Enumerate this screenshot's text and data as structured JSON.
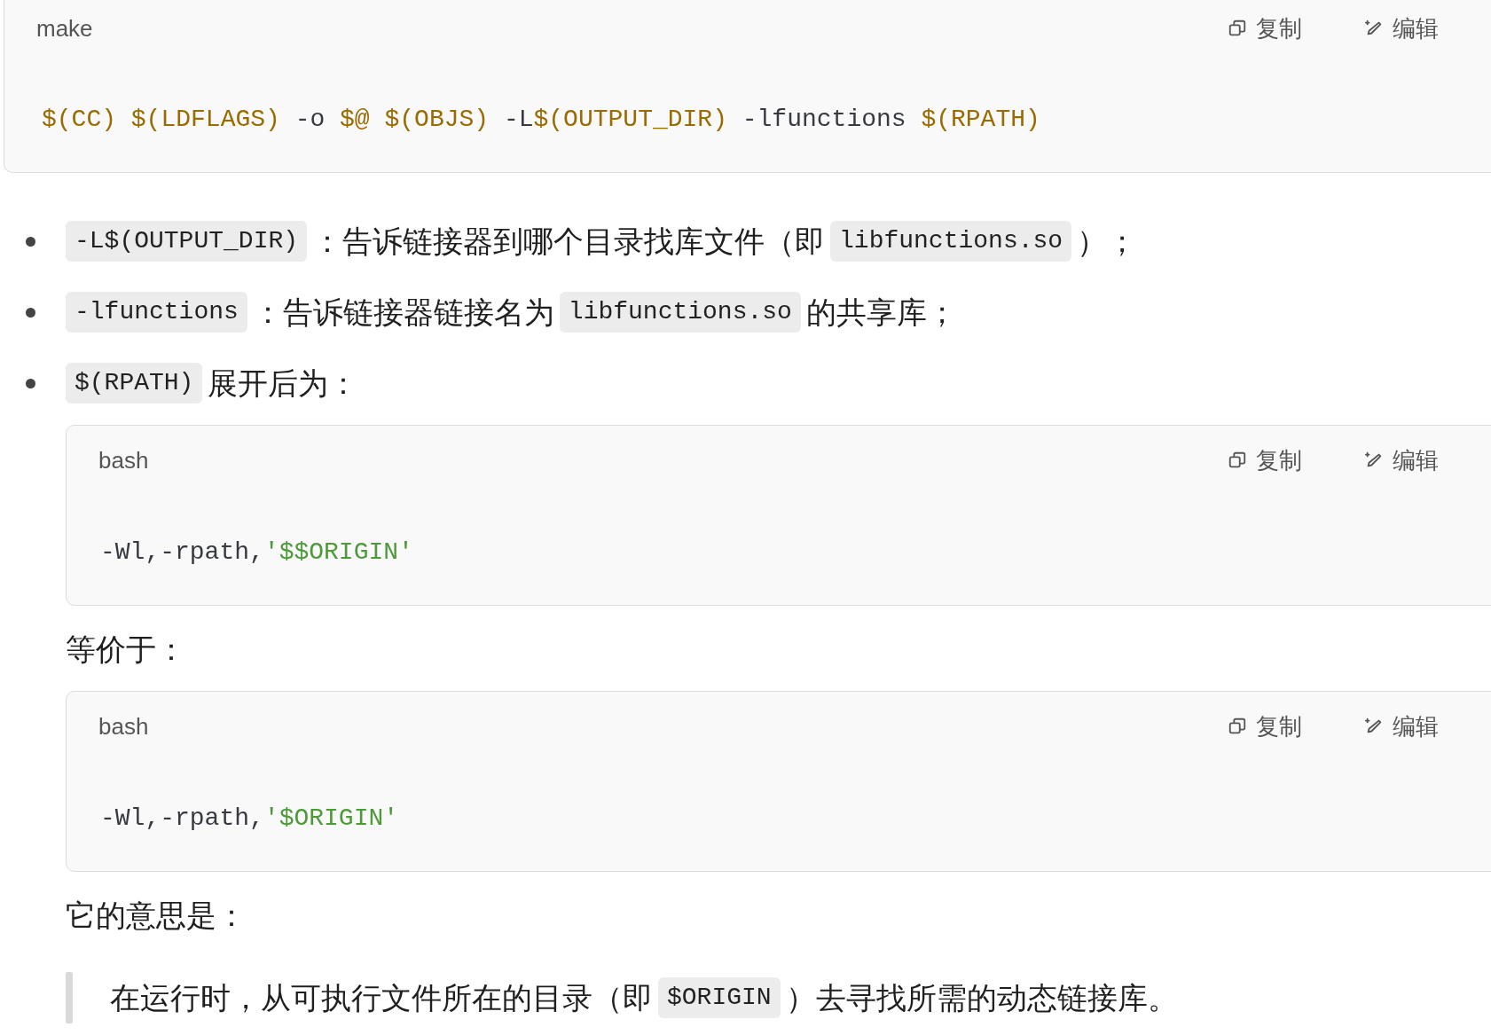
{
  "blocks": [
    {
      "kind": "code",
      "nested": false,
      "language": "make",
      "copy_label": "复制",
      "edit_label": "编辑",
      "tokens": [
        {
          "kind": "var",
          "text": "$(CC) $(LDFLAGS)"
        },
        {
          "kind": "plain",
          "text": " -o "
        },
        {
          "kind": "var",
          "text": "$@ $(OBJS)"
        },
        {
          "kind": "plain",
          "text": " -L"
        },
        {
          "kind": "var",
          "text": "$(OUTPUT_DIR)"
        },
        {
          "kind": "plain",
          "text": " -lfunctions "
        },
        {
          "kind": "var",
          "text": "$(RPATH)"
        }
      ]
    },
    {
      "kind": "bullets",
      "items": [
        {
          "segments": [
            {
              "kind": "code",
              "text": "-L$(OUTPUT_DIR)"
            },
            {
              "kind": "text",
              "text": "：告诉链接器到哪个目录找库文件（即"
            },
            {
              "kind": "code",
              "text": "libfunctions.so"
            },
            {
              "kind": "text",
              "text": "）；"
            }
          ]
        },
        {
          "segments": [
            {
              "kind": "code",
              "text": "-lfunctions"
            },
            {
              "kind": "text",
              "text": "：告诉链接器链接名为"
            },
            {
              "kind": "code",
              "text": "libfunctions.so"
            },
            {
              "kind": "text",
              "text": "的共享库；"
            }
          ]
        },
        {
          "segments": [
            {
              "kind": "code",
              "text": "$(RPATH)"
            },
            {
              "kind": "text",
              "text": "展开后为："
            }
          ]
        }
      ]
    },
    {
      "kind": "code",
      "nested": true,
      "language": "bash",
      "copy_label": "复制",
      "edit_label": "编辑",
      "tokens": [
        {
          "kind": "plain",
          "text": "-Wl,-rpath,"
        },
        {
          "kind": "string",
          "text": "'$$ORIGIN'"
        }
      ]
    },
    {
      "kind": "paragraph",
      "segments": [
        {
          "kind": "text",
          "text": "等价于："
        }
      ]
    },
    {
      "kind": "code",
      "nested": true,
      "language": "bash",
      "copy_label": "复制",
      "edit_label": "编辑",
      "tokens": [
        {
          "kind": "plain",
          "text": "-Wl,-rpath,"
        },
        {
          "kind": "string",
          "text": "'$ORIGIN'"
        }
      ]
    },
    {
      "kind": "paragraph",
      "segments": [
        {
          "kind": "text",
          "text": "它的意思是："
        }
      ]
    },
    {
      "kind": "quote",
      "segments": [
        {
          "kind": "text",
          "text": "在运行时，从可执行文件所在的目录（即"
        },
        {
          "kind": "code",
          "text": "$ORIGIN"
        },
        {
          "kind": "text",
          "text": "）去寻找所需的动态链接库。"
        }
      ]
    }
  ]
}
